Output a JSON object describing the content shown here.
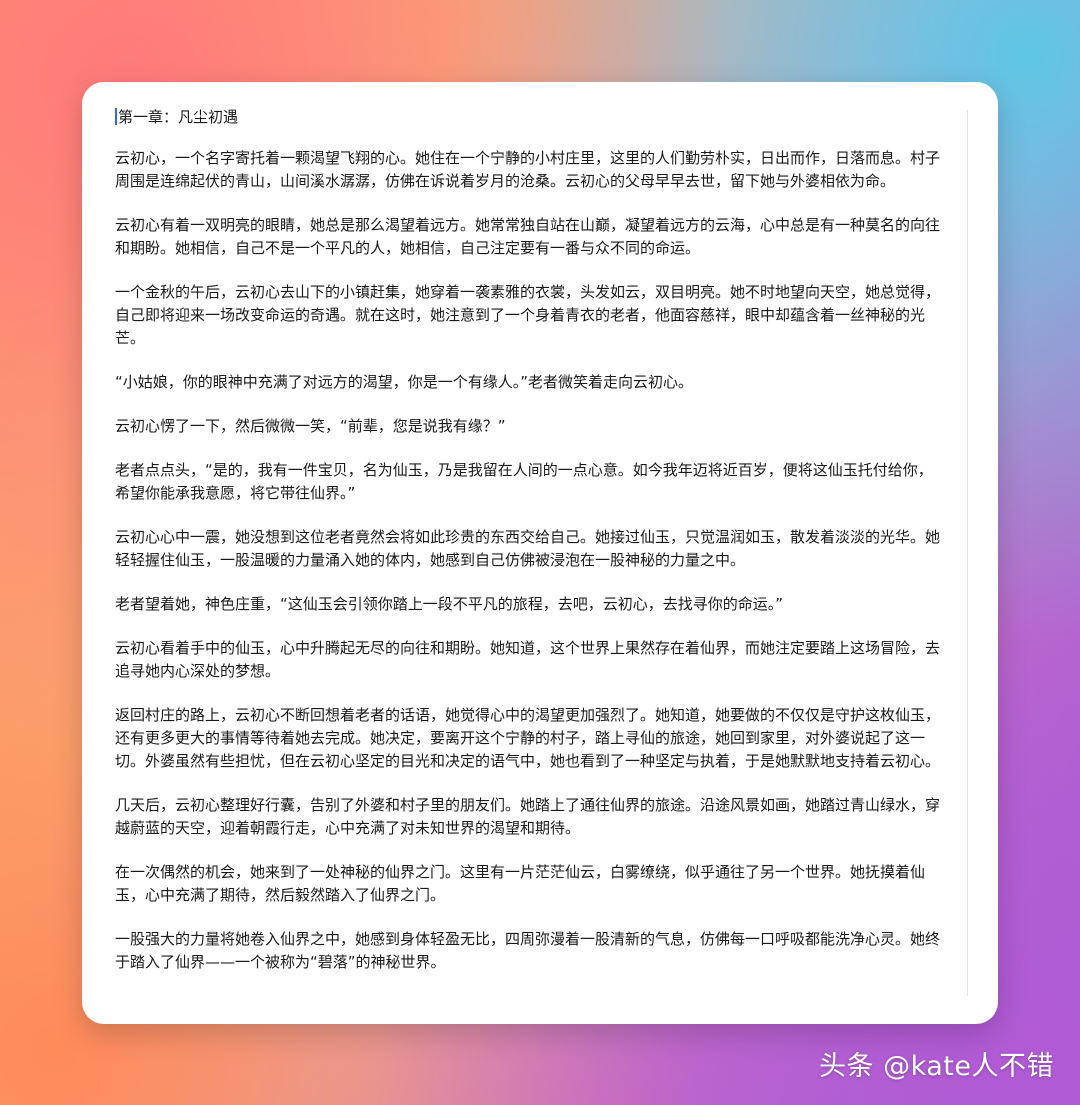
{
  "document": {
    "title": "第一章：凡尘初遇",
    "paragraphs": [
      "云初心，一个名字寄托着一颗渴望飞翔的心。她住在一个宁静的小村庄里，这里的人们勤劳朴实，日出而作，日落而息。村子周围是连绵起伏的青山，山间溪水潺潺，仿佛在诉说着岁月的沧桑。云初心的父母早早去世，留下她与外婆相依为命。",
      "云初心有着一双明亮的眼睛，她总是那么渴望着远方。她常常独自站在山巅，凝望着远方的云海，心中总是有一种莫名的向往和期盼。她相信，自己不是一个平凡的人，她相信，自己注定要有一番与众不同的命运。",
      "一个金秋的午后，云初心去山下的小镇赶集，她穿着一袭素雅的衣裳，头发如云，双目明亮。她不时地望向天空，她总觉得，自己即将迎来一场改变命运的奇遇。就在这时，她注意到了一个身着青衣的老者，他面容慈祥，眼中却蕴含着一丝神秘的光芒。",
      "“小姑娘，你的眼神中充满了对远方的渴望，你是一个有缘人。”老者微笑着走向云初心。",
      "云初心愣了一下，然后微微一笑，“前辈，您是说我有缘？”",
      "老者点点头，“是的，我有一件宝贝，名为仙玉，乃是我留在人间的一点心意。如今我年迈将近百岁，便将这仙玉托付给你，希望你能承我意愿，将它带往仙界。”",
      "云初心心中一震，她没想到这位老者竟然会将如此珍贵的东西交给自己。她接过仙玉，只觉温润如玉，散发着淡淡的光华。她轻轻握住仙玉，一股温暖的力量涌入她的体内，她感到自己仿佛被浸泡在一股神秘的力量之中。",
      "老者望着她，神色庄重，“这仙玉会引领你踏上一段不平凡的旅程，去吧，云初心，去找寻你的命运。”",
      "云初心看着手中的仙玉，心中升腾起无尽的向往和期盼。她知道，这个世界上果然存在着仙界，而她注定要踏上这场冒险，去追寻她内心深处的梦想。",
      "返回村庄的路上，云初心不断回想着老者的话语，她觉得心中的渴望更加强烈了。她知道，她要做的不仅仅是守护这枚仙玉，还有更多更大的事情等待着她去完成。她决定，要离开这个宁静的村子，踏上寻仙的旅途，她回到家里，对外婆说起了这一切。外婆虽然有些担忧，但在云初心坚定的目光和决定的语气中，她也看到了一种坚定与执着，于是她默默地支持着云初心。",
      "几天后，云初心整理好行囊，告别了外婆和村子里的朋友们。她踏上了通往仙界的旅途。沿途风景如画，她踏过青山绿水，穿越蔚蓝的天空，迎着朝霞行走，心中充满了对未知世界的渴望和期待。",
      "在一次偶然的机会，她来到了一处神秘的仙界之门。这里有一片茫茫仙云，白雾缭绕，似乎通往了另一个世界。她抚摸着仙玉，心中充满了期待，然后毅然踏入了仙界之门。",
      "一股强大的力量将她卷入仙界之中，她感到身体轻盈无比，四周弥漫着一股清新的气息，仿佛每一口呼吸都能洗净心灵。她终于踏入了仙界——一个被称为“碧落”的神秘世界。"
    ]
  },
  "watermark": "头条 @kate人不错",
  "colors": {
    "caret": "#2d6cdf",
    "text": "#1a1a1a",
    "card": "#ffffff"
  }
}
